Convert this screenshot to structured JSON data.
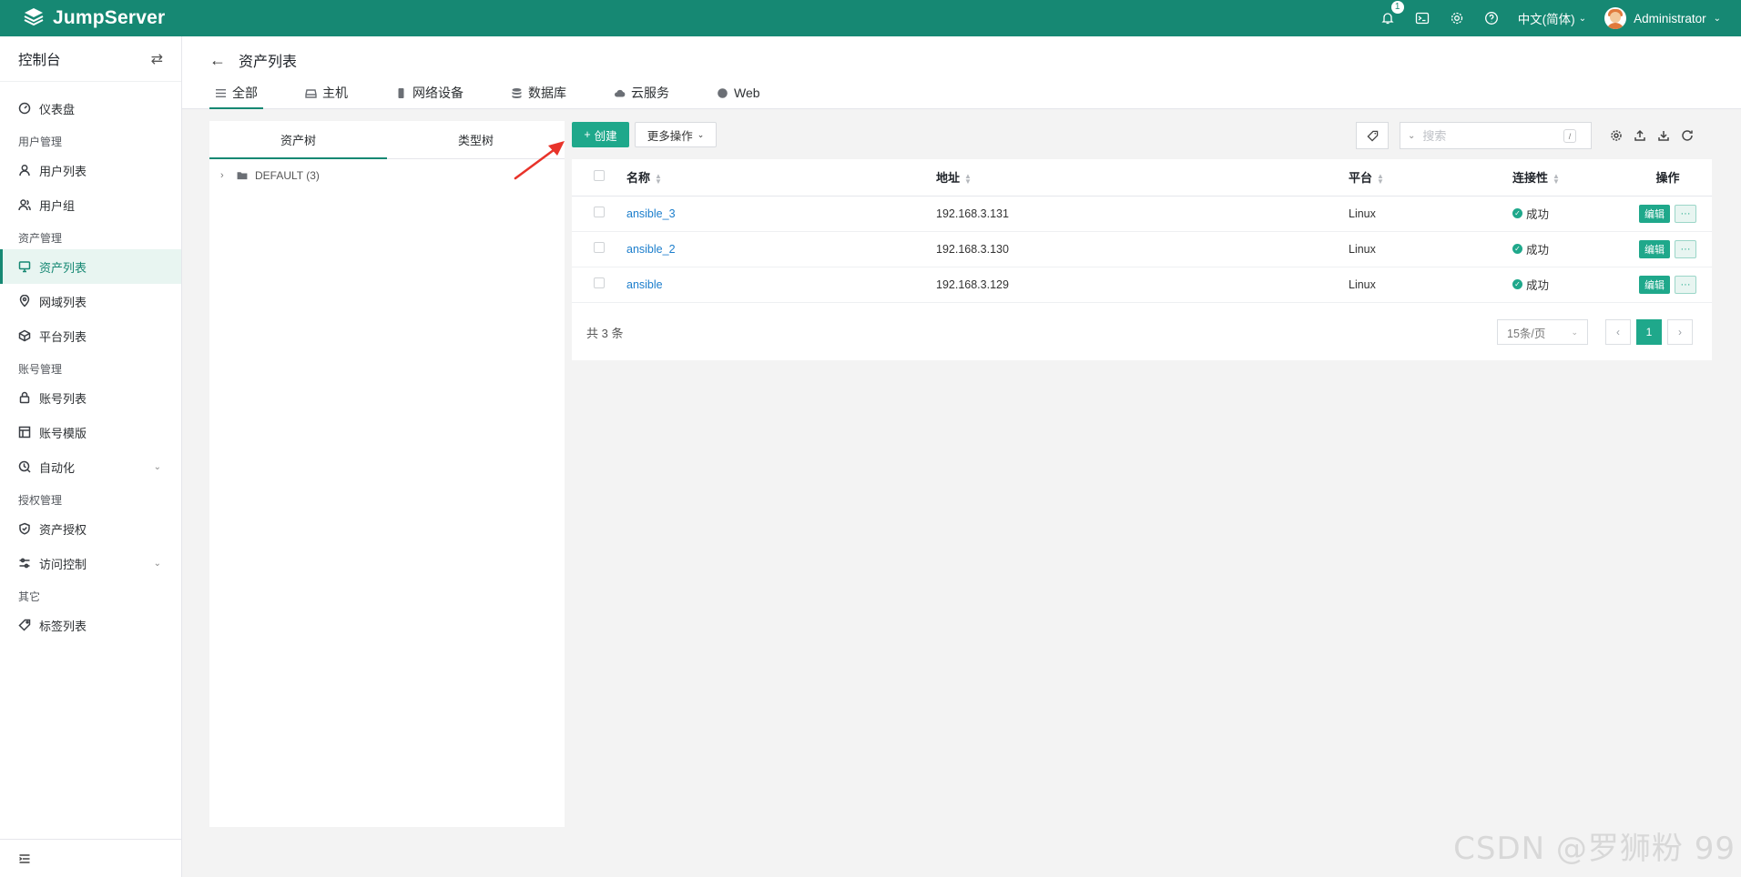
{
  "topbar": {
    "logo_text": "JumpServer",
    "notification_count": "1",
    "language": "中文(简体)",
    "user_name": "Administrator",
    "bg_color": "#168873"
  },
  "sidebar": {
    "header": "控制台",
    "dashboard": "仪表盘",
    "groups": {
      "user_mgmt": "用户管理",
      "asset_mgmt": "资产管理",
      "account_mgmt": "账号管理",
      "perm_mgmt": "授权管理",
      "other": "其它"
    },
    "items": {
      "user_list": "用户列表",
      "user_group": "用户组",
      "asset_list": "资产列表",
      "zone_list": "网域列表",
      "platform_list": "平台列表",
      "account_list": "账号列表",
      "account_template": "账号模版",
      "automation": "自动化",
      "asset_perm": "资产授权",
      "access_control": "访问控制",
      "tag_list": "标签列表"
    }
  },
  "page": {
    "title": "资产列表",
    "tabs": [
      "全部",
      "主机",
      "网络设备",
      "数据库",
      "云服务",
      "Web"
    ]
  },
  "tree": {
    "tabs": [
      "资产树",
      "类型树"
    ],
    "root_node": "DEFAULT (3)"
  },
  "toolbar": {
    "create_label": "创建",
    "more_label": "更多操作",
    "search_placeholder": "搜索",
    "search_shortcut": "/"
  },
  "table": {
    "headers": {
      "name": "名称",
      "address": "地址",
      "platform": "平台",
      "connectivity": "连接性",
      "actions": "操作"
    },
    "rows": [
      {
        "name": "ansible_3",
        "address": "192.168.3.131",
        "platform": "Linux",
        "connectivity": "成功"
      },
      {
        "name": "ansible_2",
        "address": "192.168.3.130",
        "platform": "Linux",
        "connectivity": "成功"
      },
      {
        "name": "ansible",
        "address": "192.168.3.129",
        "platform": "Linux",
        "connectivity": "成功"
      }
    ],
    "edit_label": "编辑",
    "more_dots": "···",
    "total_text": "共 3 条",
    "page_size": "15条/页",
    "current_page": "1"
  },
  "watermark": "CSDN @罗狮粉 99",
  "colors": {
    "accent": "#1fa88b",
    "link": "#1c7ecc",
    "annotation": "#e8332a"
  }
}
